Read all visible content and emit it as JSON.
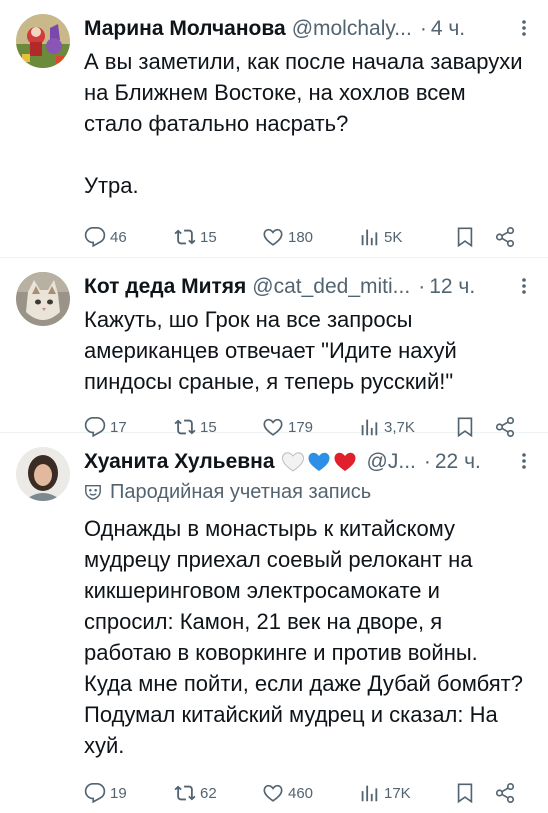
{
  "tweets": [
    {
      "name": "Марина Молчанова",
      "handle": "@molchaly...",
      "dot": "·",
      "time": "4 ч.",
      "text": "А вы заметили, как после начала заварухи на Ближнем Востоке, на хохлов всем стало фатально насрать?\n\nУтра.",
      "replies": "46",
      "retweets": "15",
      "likes": "180",
      "views": "5K"
    },
    {
      "name": "Кот деда Митяя",
      "handle": "@cat_ded_miti...",
      "dot": "·",
      "time": "12 ч.",
      "text": "Кажуть, шо Грок на все запросы американцев отвечает \"Идите нахуй пиндосы сраные, я теперь русский!\"",
      "replies": "17",
      "retweets": "15",
      "likes": "179",
      "views": "3,7K"
    },
    {
      "name": "Хуанита Хульевна",
      "handle": "@J...",
      "dot": "·",
      "time": "22 ч.",
      "badge": "Пародийная учетная запись",
      "text": "Однажды в монастырь к китайскому мудрецу приехал соевый релокант на кикшеринговом электросамокате и спросил: Камон, 21 век на дворе, я работаю в коворкинге и против войны. Куда мне пойти, если даже Дубай бомбят? Подумал китайский мудрец и сказал: На хуй.",
      "replies": "19",
      "retweets": "62",
      "likes": "460",
      "views": "17K"
    }
  ],
  "colors": {
    "text": "#0f1419",
    "muted": "#536471",
    "divider": "#eff3f4",
    "heart_white": "#e8e8e8",
    "heart_blue": "#2e8fe6",
    "heart_red": "#e0202a"
  },
  "icons": [
    "more-icon",
    "reply-icon",
    "retweet-icon",
    "like-icon",
    "views-icon",
    "bookmark-icon",
    "share-icon",
    "parody-mask-icon"
  ]
}
